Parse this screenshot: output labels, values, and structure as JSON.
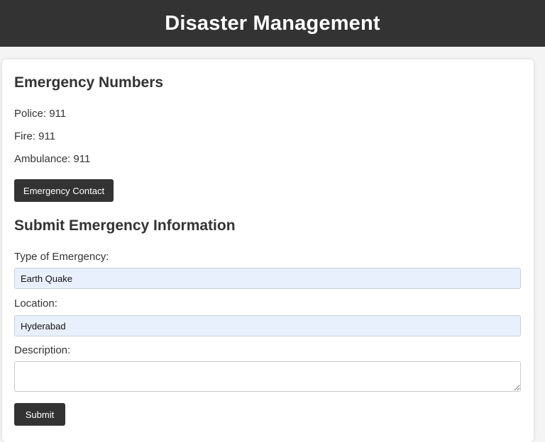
{
  "header": {
    "title": "Disaster Management"
  },
  "emergency_numbers": {
    "title": "Emergency Numbers",
    "police": "Police: 911",
    "fire": "Fire: 911",
    "ambulance": "Ambulance: 911",
    "contact_button": "Emergency Contact"
  },
  "form": {
    "title": "Submit Emergency Information",
    "type_label": "Type of Emergency:",
    "type_value": "Earth Quake",
    "location_label": "Location:",
    "location_value": "Hyderabad",
    "description_label": "Description:",
    "description_value": "",
    "submit_button": "Submit"
  },
  "colors": {
    "header_bg": "#333333",
    "button_bg": "#333333",
    "autofill_bg": "#e8f0fe",
    "page_bg": "#f4f4f4"
  }
}
